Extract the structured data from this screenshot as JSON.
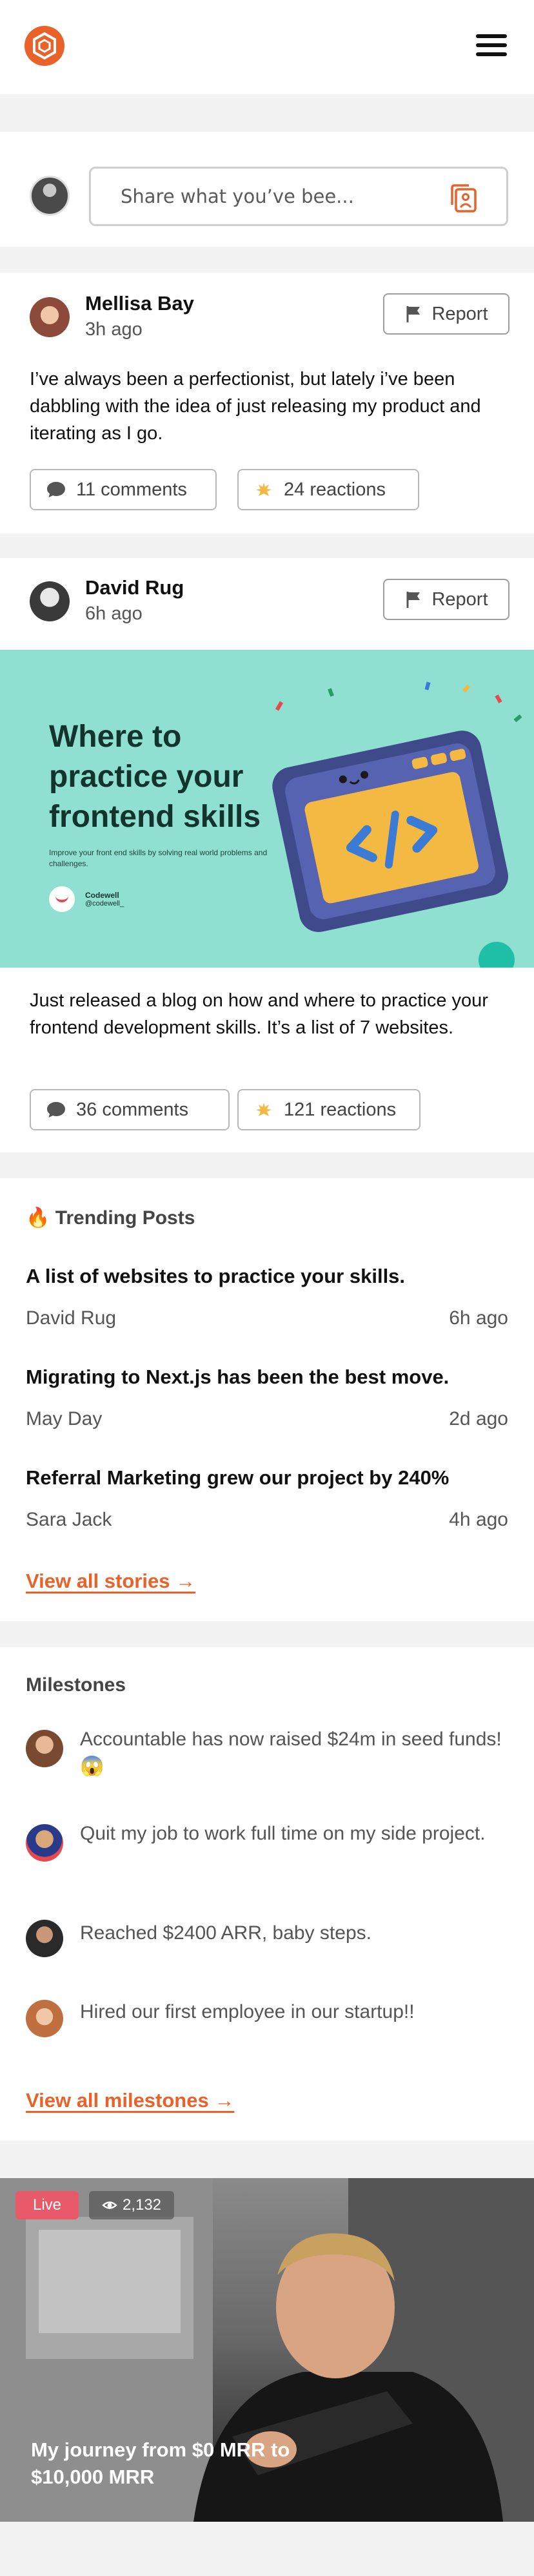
{
  "composer": {
    "placeholder": "Share what you’ve bee..."
  },
  "posts": [
    {
      "author": "Mellisa Bay",
      "time": "3h ago",
      "report_label": "Report",
      "text": "I’ve always been a perfectionist, but lately i’ve been dabbling with the idea of just releasing my product and iterating as I go.",
      "comments": "11 comments",
      "reactions": "24 reactions"
    },
    {
      "author": "David Rug",
      "time": "6h ago",
      "report_label": "Report",
      "image": {
        "title": "Where to practice your frontend skills",
        "subtitle": "Improve your front end skills by solving real world problems and challenges.",
        "brand": "Codewell",
        "handle": "@codewell_"
      },
      "text": "Just released a blog on how and where to practice your frontend development skills. It’s a list of 7 websites.",
      "comments": "36 comments",
      "reactions": "121 reactions"
    }
  ],
  "trending": {
    "emoji": "🔥",
    "title": "Trending Posts",
    "items": [
      {
        "title": "A list of websites to practice your skills.",
        "author": "David Rug",
        "time": "6h ago"
      },
      {
        "title": "Migrating to Next.js has been the best move.",
        "author": "May Day",
        "time": "2d ago"
      },
      {
        "title": "Referral Marketing grew our project by 240%",
        "author": "Sara Jack",
        "time": "4h ago"
      }
    ],
    "view_all": "View all stories →"
  },
  "milestones": {
    "title": "Milestones",
    "items": [
      {
        "text": "Accountable has now raised $24m in seed funds! 😱"
      },
      {
        "text": "Quit my job to work full time on my side project."
      },
      {
        "text": "Reached $2400 ARR, baby steps."
      },
      {
        "text": "Hired our first employee in our startup!!"
      }
    ],
    "view_all": "View all milestones →"
  },
  "live": {
    "badge": "Live",
    "views": "2,132",
    "title": "My journey from $0 MRR to $10,000 MRR"
  },
  "colors": {
    "accent": "#e8622a",
    "banner": "#8fe0d0",
    "live": "#e85a6a"
  }
}
